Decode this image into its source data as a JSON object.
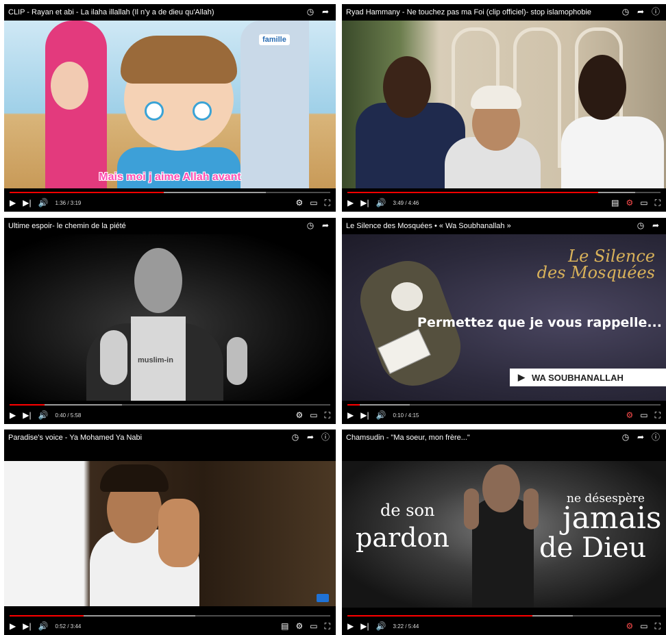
{
  "videos": [
    {
      "title": "CLIP - Rayan et abi - La ilaha illallah (Il n'y a de dieu qu'Allah)",
      "time": "1:36 / 3:19",
      "progress": 0.48,
      "subtitle": "Mais moi j aime Allah avant",
      "logo": "famille"
    },
    {
      "title": "Ryad Hammany - Ne touchez pas ma Foi (clip officiel)- stop islamophobie",
      "time": "3:49 / 4:46",
      "progress": 0.8
    },
    {
      "title": "Ultime espoir- le chemin de la piété",
      "time": "0:40 / 5:58",
      "progress": 0.11,
      "shirt_text": "muslim-in"
    },
    {
      "title": "Le Silence des Mosquées • « Wa Soubhanallah »",
      "time": "0:10 / 4:15",
      "progress": 0.04,
      "overlay_title_1": "Le Silence",
      "overlay_title_2": "des Mosquées",
      "overlay_text": "Permettez que je vous rappelle...",
      "overlay_button": "WA SOUBHANALLAH"
    },
    {
      "title": "Paradise's voice - Ya Mohamed Ya Nabi",
      "time": "0:52 / 3:44",
      "progress": 0.23
    },
    {
      "title": "Chamsudin - \"Ma soeur, mon frère...\"",
      "time": "3:22 / 5:44",
      "progress": 0.59,
      "text_1": "de son",
      "text_2": "pardon",
      "text_3": "ne désespère",
      "text_4": "jamais",
      "text_5": "de Dieu"
    }
  ],
  "icons": {
    "play": "▶",
    "next": "▶|",
    "volume": "🔊",
    "settings": "⚙",
    "cast": "▭",
    "exit_fullscreen": "⛶",
    "watch_later": "◷",
    "share": "➦",
    "info": "ⓘ",
    "subtitles": "▤",
    "quality_hd": "⚙"
  },
  "colors": {
    "progress": "#ff0000",
    "player_bg": "#000000"
  }
}
